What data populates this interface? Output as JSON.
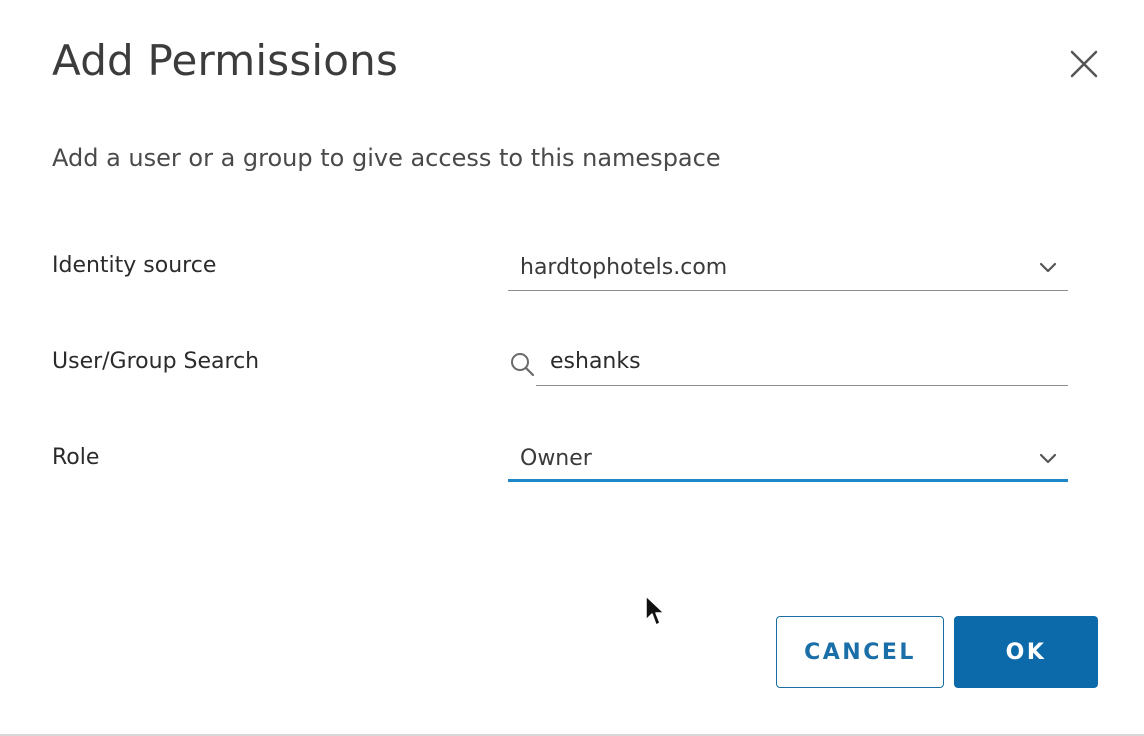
{
  "dialog": {
    "title": "Add Permissions",
    "close_icon": "close-icon",
    "subtitle": "Add a user or a group to give access to this namespace"
  },
  "form": {
    "identity_source": {
      "label": "Identity source",
      "value": "hardtophotels.com",
      "icon": "chevron-down-icon"
    },
    "user_group_search": {
      "label": "User/Group Search",
      "value": "eshanks",
      "icon": "search-icon"
    },
    "role": {
      "label": "Role",
      "value": "Owner",
      "icon": "chevron-down-icon",
      "focused": true
    }
  },
  "actions": {
    "cancel_label": "CANCEL",
    "ok_label": "OK"
  },
  "colors": {
    "primary": "#0c6aaa",
    "focus_underline": "#1f88c8",
    "text": "#333333"
  }
}
